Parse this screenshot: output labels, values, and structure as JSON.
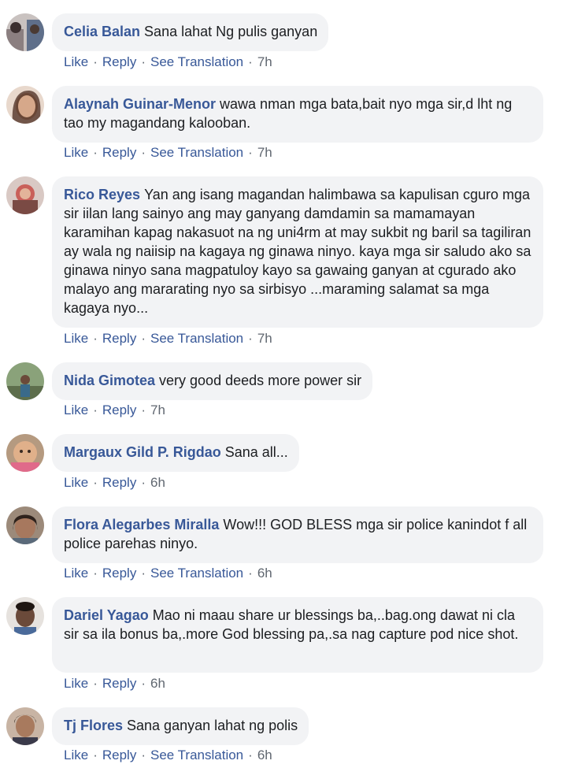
{
  "actions": {
    "like": "Like",
    "reply": "Reply",
    "see_translation": "See Translation",
    "separator": "·"
  },
  "comments": [
    {
      "author": "Celia Balan",
      "text": "Sana lahat Ng pulis ganyan",
      "time": "7h",
      "has_translation": true,
      "avatar_color": "#8b7f80"
    },
    {
      "author": "Alaynah Guinar-Menor",
      "text": "wawa nman mga bata,bait nyo mga sir,d lht ng tao my magandang kalooban.",
      "time": "7h",
      "has_translation": true,
      "avatar_color": "#b88a70"
    },
    {
      "author": "Rico Reyes",
      "text": "Yan ang isang magandan halimbawa sa kapulisan cguro mga sir iilan lang sainyo ang may ganyang damdamin sa mamamayan karamihan kapag nakasuot na ng uni4rm at may sukbit ng baril sa tagiliran ay wala ng naiisip na kagaya ng ginawa ninyo. kaya mga sir saludo ako sa ginawa ninyo sana magpatuloy kayo sa gawaing ganyan at cgurado ako malayo ang mararating nyo sa sirbisyo ...maraming salamat sa mga kagaya nyo...",
      "time": "7h",
      "has_translation": true,
      "avatar_color": "#c9605a"
    },
    {
      "author": "Nida Gimotea",
      "text": "very good deeds more power sir",
      "time": "7h",
      "has_translation": false,
      "avatar_color": "#6f8a62"
    },
    {
      "author": "Margaux Gild P. Rigdao",
      "text": "Sana all...",
      "time": "6h",
      "has_translation": false,
      "avatar_color": "#d0a070"
    },
    {
      "author": "Flora Alegarbes Miralla",
      "text": "Wow!!! GOD BLESS mga sir police kanindot f all police parehas ninyo.",
      "time": "6h",
      "has_translation": true,
      "avatar_color": "#8a6a55"
    },
    {
      "author": "Dariel Yagao",
      "text": "Mao ni maau share ur blessings ba,..bag.ong dawat ni cla sir sa ila bonus ba,.more God blessing pa,.sa nag capture pod nice shot.",
      "time": "6h",
      "has_translation": false,
      "avatar_color": "#6b4a3a"
    },
    {
      "author": "Tj Flores",
      "text": "Sana ganyan lahat ng polis",
      "time": "6h",
      "has_translation": true,
      "avatar_color": "#6a4a3c"
    }
  ]
}
